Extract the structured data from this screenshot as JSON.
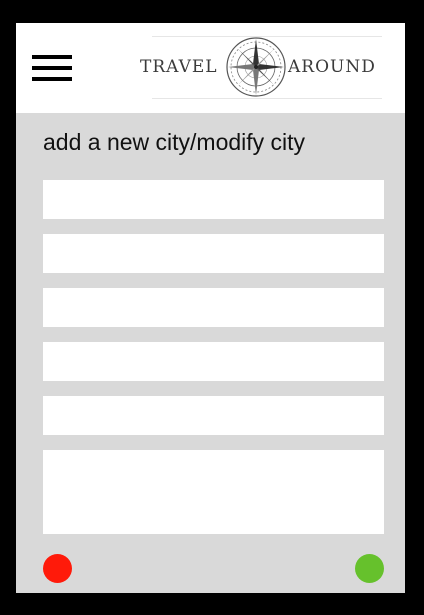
{
  "header": {
    "logo": {
      "text_left": "TRAVEL",
      "text_right": "AROUND",
      "emblem": "compass-rose"
    },
    "menu_icon": "hamburger-menu-icon"
  },
  "form": {
    "title": "add a new city/modify city",
    "fields": [
      {
        "value": "",
        "placeholder": ""
      },
      {
        "value": "",
        "placeholder": ""
      },
      {
        "value": "",
        "placeholder": ""
      },
      {
        "value": "",
        "placeholder": ""
      },
      {
        "value": "",
        "placeholder": ""
      }
    ],
    "textarea": {
      "value": "",
      "placeholder": ""
    }
  },
  "actions": {
    "cancel": {
      "icon": "red-circle",
      "color": "#ff1a0a"
    },
    "confirm": {
      "icon": "green-circle",
      "color": "#66c12c"
    }
  },
  "colors": {
    "frame": "#000000",
    "header_bg": "#ffffff",
    "panel_bg": "#d9d9d9",
    "field_bg": "#ffffff"
  }
}
